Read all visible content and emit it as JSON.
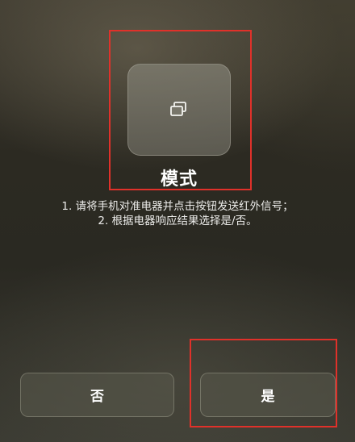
{
  "mode_card": {
    "label": "模式",
    "icon": "window-copy-icon"
  },
  "instructions": [
    "1. 请将手机对准电器并点击按钮发送红外信号；",
    "2. 根据电器响应结果选择是/否。"
  ],
  "buttons": {
    "no_label": "否",
    "yes_label": "是"
  },
  "annotation_color": "#e0312a"
}
